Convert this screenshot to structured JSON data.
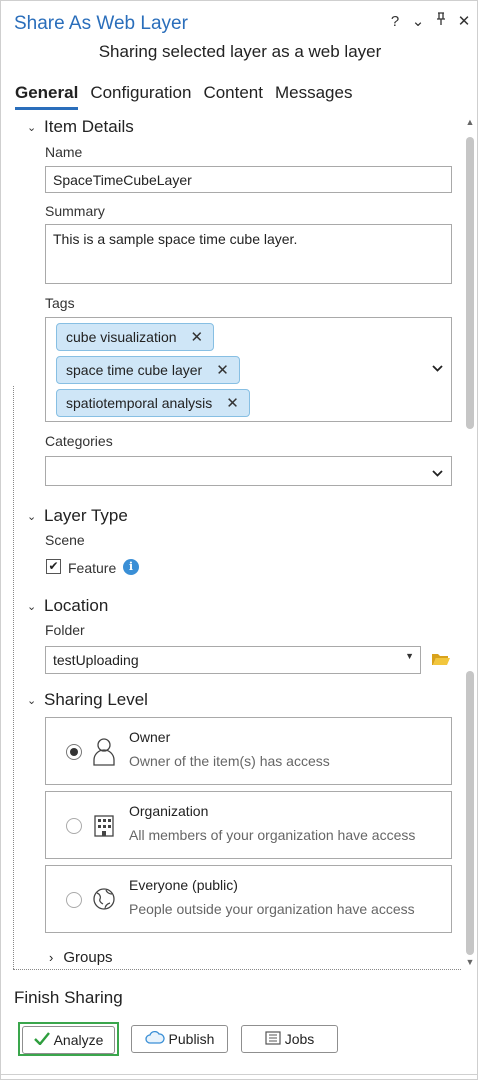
{
  "window": {
    "title": "Share As Web Layer",
    "subtitle": "Sharing selected layer as a web layer",
    "controls": {
      "help": "?",
      "menu": "⌄",
      "pin": "⊥",
      "close": "✕"
    }
  },
  "tabs": [
    {
      "label": "General",
      "active": true
    },
    {
      "label": "Configuration",
      "active": false
    },
    {
      "label": "Content",
      "active": false
    },
    {
      "label": "Messages",
      "active": false
    }
  ],
  "item_details": {
    "heading": "Item Details",
    "name_label": "Name",
    "name_value": "SpaceTimeCubeLayer",
    "summary_label": "Summary",
    "summary_value": "This is a sample space time cube layer.",
    "tags_label": "Tags",
    "tags": [
      "cube visualization",
      "space time cube layer",
      "spatiotemporal analysis"
    ],
    "categories_label": "Categories",
    "categories_value": ""
  },
  "layer_type": {
    "heading": "Layer Type",
    "scene_label": "Scene",
    "feature_label": "Feature",
    "feature_checked": true
  },
  "location": {
    "heading": "Location",
    "folder_label": "Folder",
    "folder_value": "testUploading"
  },
  "sharing_level": {
    "heading": "Sharing Level",
    "options": [
      {
        "title": "Owner",
        "desc": "Owner of the item(s) has access",
        "selected": true
      },
      {
        "title": "Organization",
        "desc": "All members of your organization have access",
        "selected": false
      },
      {
        "title": "Everyone (public)",
        "desc": "People outside your organization have access",
        "selected": false
      }
    ],
    "groups_label": "Groups"
  },
  "finish": {
    "heading": "Finish Sharing",
    "analyze_label": "Analyze",
    "publish_label": "Publish",
    "jobs_label": "Jobs"
  },
  "colors": {
    "accent": "#2a6ebb",
    "tag_fill": "#cfe6f7",
    "highlight_green": "#3aa64c",
    "info_blue": "#3a8fd6",
    "folder_yellow": "#e8b923"
  }
}
